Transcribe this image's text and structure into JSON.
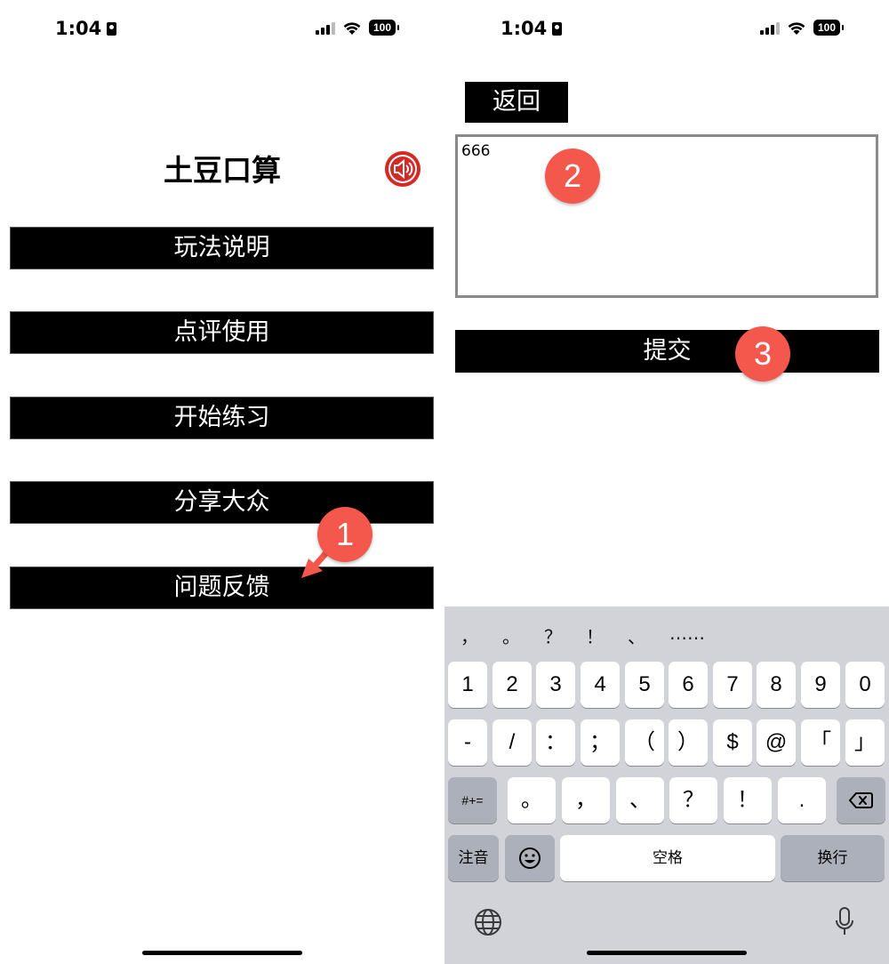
{
  "status_bar": {
    "time": "1:04",
    "battery": "100"
  },
  "left": {
    "title": "土豆口算",
    "menu": [
      {
        "label": "玩法说明"
      },
      {
        "label": "点评使用"
      },
      {
        "label": "开始练习"
      },
      {
        "label": "分享大众"
      },
      {
        "label": "问题反馈"
      }
    ],
    "annotation": "1"
  },
  "right": {
    "back_label": "返回",
    "feedback_value": "666",
    "submit_label": "提交",
    "annotations": [
      "2",
      "3"
    ]
  },
  "keyboard": {
    "suggestions": [
      "，",
      "。",
      "？",
      "！",
      "、",
      "……"
    ],
    "number_row": [
      "1",
      "2",
      "3",
      "4",
      "5",
      "6",
      "7",
      "8",
      "9",
      "0"
    ],
    "symbol_row": [
      "-",
      "/",
      "：",
      "；",
      "（",
      "）",
      "$",
      "@",
      "「",
      "」"
    ],
    "punct_row": [
      "。",
      "，",
      "、",
      "？",
      "！",
      "."
    ],
    "more_symbols_label": "#+=",
    "zhuyin_label": "注音",
    "space_label": "空格",
    "return_label": "换行"
  },
  "colors": {
    "button_bg": "#000000",
    "badge": "#f4574b",
    "speaker": "#d42a25",
    "keyboard_bg": "#d1d3d9"
  }
}
